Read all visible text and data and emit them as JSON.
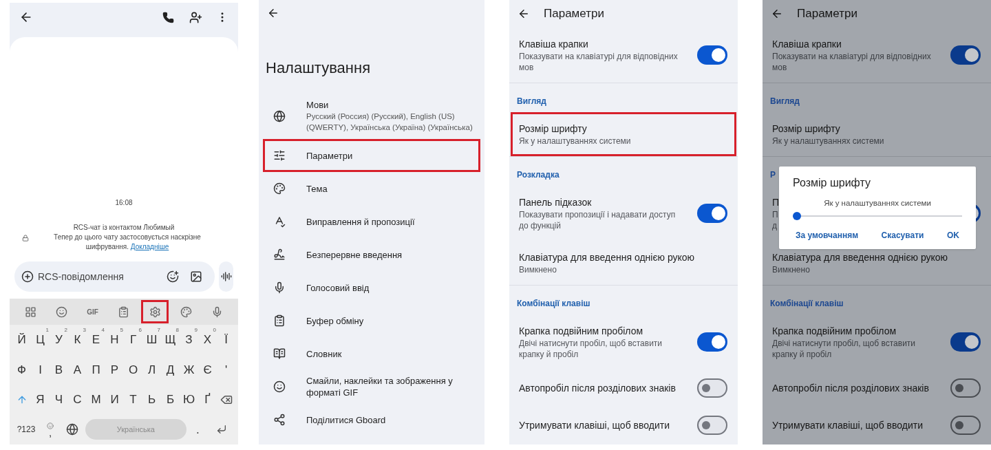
{
  "chat_screen": {
    "chat": {
      "time": "16:08",
      "info_title": "RCS-чат із контактом Любимый",
      "info_text": "Тепер до цього чату застосовується наскрізне шифрування.",
      "info_link": "Докладніше"
    },
    "compose": {
      "placeholder": "RCS-повідомлення"
    },
    "keyboard": {
      "toolbar": [
        {
          "kind": "icon",
          "highlighted": false
        },
        {
          "kind": "icon",
          "highlighted": false
        },
        {
          "kind": "text",
          "label": "GIF",
          "highlighted": false
        },
        {
          "kind": "icon",
          "highlighted": false
        },
        {
          "kind": "icon",
          "highlighted": true
        },
        {
          "kind": "icon",
          "highlighted": false
        },
        {
          "kind": "icon",
          "highlighted": false
        }
      ],
      "rows": [
        {
          "keys": [
            {
              "kind": "letter",
              "label": "Й"
            },
            {
              "kind": "letter",
              "label": "Ц",
              "hint": "1"
            },
            {
              "kind": "letter",
              "label": "У",
              "hint": "2"
            },
            {
              "kind": "letter",
              "label": "К",
              "hint": "3"
            },
            {
              "kind": "letter",
              "label": "Е",
              "hint": "4"
            },
            {
              "kind": "letter",
              "label": "Н",
              "hint": "5"
            },
            {
              "kind": "letter",
              "label": "Г",
              "hint": "6"
            },
            {
              "kind": "letter",
              "label": "Ш",
              "hint": "7"
            },
            {
              "kind": "letter",
              "label": "Щ",
              "hint": "8"
            },
            {
              "kind": "letter",
              "label": "З",
              "hint": "9"
            },
            {
              "kind": "letter",
              "label": "Х",
              "hint": "0"
            },
            {
              "kind": "letter",
              "label": "Ї"
            }
          ]
        },
        {
          "keys": [
            {
              "kind": "letter",
              "label": "Ф"
            },
            {
              "kind": "letter",
              "label": "І"
            },
            {
              "kind": "letter",
              "label": "В"
            },
            {
              "kind": "letter",
              "label": "А"
            },
            {
              "kind": "letter",
              "label": "П"
            },
            {
              "kind": "letter",
              "label": "Р"
            },
            {
              "kind": "letter",
              "label": "О"
            },
            {
              "kind": "letter",
              "label": "Л"
            },
            {
              "kind": "letter",
              "label": "Д"
            },
            {
              "kind": "letter",
              "label": "Ж"
            },
            {
              "kind": "letter",
              "label": "Є"
            },
            {
              "kind": "letter",
              "label": "'"
            }
          ]
        },
        {
          "keys": [
            {
              "kind": "shift"
            },
            {
              "kind": "letter",
              "label": "Я"
            },
            {
              "kind": "letter",
              "label": "Ч"
            },
            {
              "kind": "letter",
              "label": "С"
            },
            {
              "kind": "letter",
              "label": "М"
            },
            {
              "kind": "letter",
              "label": "И"
            },
            {
              "kind": "letter",
              "label": "Т"
            },
            {
              "kind": "letter",
              "label": "Ь"
            },
            {
              "kind": "letter",
              "label": "Б"
            },
            {
              "kind": "letter",
              "label": "Ю"
            },
            {
              "kind": "letter",
              "label": "Ґ"
            },
            {
              "kind": "backspace"
            }
          ]
        },
        {
          "keys": [
            {
              "kind": "small",
              "label": "?123"
            },
            {
              "kind": "comma",
              "label": ","
            },
            {
              "kind": "globe"
            },
            {
              "kind": "space",
              "label": "Українська"
            },
            {
              "kind": "letter",
              "label": "."
            },
            {
              "kind": "enter"
            }
          ]
        }
      ]
    }
  },
  "settings_screen": {
    "title": "Налаштування",
    "items": [
      {
        "label": "Мови",
        "subtitle": "Русский (Россия) (Русский), English (US) (QWERTY), Українська (Україна) (Українська)",
        "highlighted": false
      },
      {
        "label": "Параметри",
        "highlighted": true
      },
      {
        "label": "Тема",
        "highlighted": false
      },
      {
        "label": "Виправлення й пропозиції",
        "highlighted": false
      },
      {
        "label": "Безперервне введення",
        "highlighted": false
      },
      {
        "label": "Голосовий ввід",
        "highlighted": false
      },
      {
        "label": "Буфер обміну",
        "highlighted": false
      },
      {
        "label": "Словник",
        "highlighted": false
      },
      {
        "label": "Смайли, наклейки та зображення у форматі GIF",
        "highlighted": false
      },
      {
        "label": "Поділитися Gboard",
        "highlighted": false
      }
    ]
  },
  "preferences_screens": [
    {
      "title": "Параметри",
      "dimmed": false,
      "items": [
        {
          "kind": "toggle",
          "label": "Клавіша крапки",
          "subtitle": "Показувати на клавіатурі для відповідних мов",
          "on": true,
          "highlighted": false
        },
        {
          "kind": "divider"
        },
        {
          "kind": "section",
          "label": "Вигляд"
        },
        {
          "kind": "text",
          "label": "Розмір шрифту",
          "subtitle": "Як у налаштуваннях системи",
          "highlighted": true
        },
        {
          "kind": "divider"
        },
        {
          "kind": "section",
          "label": "Розкладка"
        },
        {
          "kind": "toggle",
          "label": "Панель підказок",
          "subtitle": "Показувати пропозиції і надавати доступ до функцій",
          "on": true,
          "highlighted": false
        },
        {
          "kind": "text",
          "label": "Клавіатура для введення однією рукою",
          "subtitle": "Вимкнено",
          "highlighted": false
        },
        {
          "kind": "divider"
        },
        {
          "kind": "section",
          "label": "Комбінації клавіш"
        },
        {
          "kind": "toggle",
          "label": "Крапка подвійним пробілом",
          "subtitle": "Двічі натиснути пробіл, щоб вставити крапку й пробіл",
          "on": true,
          "highlighted": false
        },
        {
          "kind": "toggle",
          "label": "Автопробіл після розділових знаків",
          "on": false,
          "highlighted": false
        },
        {
          "kind": "toggle",
          "label": "Утримувати клавіші, щоб вводити",
          "on": false,
          "highlighted": false
        }
      ]
    },
    {
      "title": "Параметри",
      "dimmed": true,
      "items": [
        {
          "kind": "toggle",
          "label": "Клавіша крапки",
          "subtitle": "Показувати на клавіатурі для відповідних мов",
          "on": true,
          "highlighted": false
        },
        {
          "kind": "divider"
        },
        {
          "kind": "section",
          "label": "Вигляд"
        },
        {
          "kind": "text",
          "label": "Розмір шрифту",
          "subtitle": "Як у налаштуваннях системи",
          "highlighted": false
        },
        {
          "kind": "divider"
        },
        {
          "kind": "section",
          "label": "Р"
        },
        {
          "kind": "toggle",
          "label": "П",
          "subtitle": "П\nд",
          "on": true,
          "highlighted": false
        },
        {
          "kind": "text",
          "label": "Клавіатура для введення однією рукою",
          "subtitle": "Вимкнено",
          "highlighted": false
        },
        {
          "kind": "divider"
        },
        {
          "kind": "section",
          "label": "Комбінації клавіш"
        },
        {
          "kind": "toggle",
          "label": "Крапка подвійним пробілом",
          "subtitle": "Двічі натиснути пробіл, щоб вставити крапку й пробіл",
          "on": true,
          "highlighted": false
        },
        {
          "kind": "toggle",
          "label": "Автопробіл після розділових знаків",
          "on": false,
          "highlighted": false
        },
        {
          "kind": "toggle",
          "label": "Утримувати клавіші, щоб вводити",
          "on": false,
          "highlighted": false
        }
      ],
      "dialog": {
        "title": "Розмір шрифту",
        "subtitle": "Як у налаштуваннях системи",
        "level": 0,
        "buttons": [
          "За умовчанням",
          "Скасувати",
          "OK"
        ]
      }
    }
  ]
}
